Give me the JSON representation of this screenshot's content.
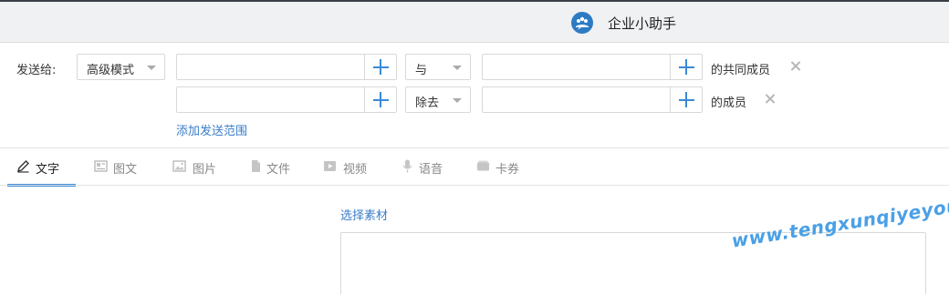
{
  "header": {
    "title": "企业小助手",
    "logo_icon": "group-chat-icon"
  },
  "send_to": {
    "label": "发送给:",
    "mode_select": "高级模式",
    "row1": {
      "left_placeholder": "",
      "operator": "与",
      "right_placeholder": "",
      "suffix": "的共同成员"
    },
    "row2": {
      "left_placeholder": "",
      "operator": "除去",
      "right_placeholder": "",
      "suffix": "的成员"
    },
    "add_range_link": "添加发送范围"
  },
  "tabs": [
    {
      "label": "文字",
      "icon": "pencil-icon",
      "active": true
    },
    {
      "label": "图文",
      "icon": "article-icon",
      "active": false
    },
    {
      "label": "图片",
      "icon": "image-icon",
      "active": false
    },
    {
      "label": "文件",
      "icon": "file-icon",
      "active": false
    },
    {
      "label": "视频",
      "icon": "video-icon",
      "active": false
    },
    {
      "label": "语音",
      "icon": "microphone-icon",
      "active": false
    },
    {
      "label": "卡券",
      "icon": "coupon-icon",
      "active": false
    }
  ],
  "content": {
    "select_material_link": "选择素材"
  },
  "watermark": "www.tengxunqiyeyou.com",
  "colors": {
    "accent": "#3a8ad6",
    "link": "#3a7dc9",
    "header_bg": "#f0f1f3",
    "watermark": "#4aa0e6"
  }
}
